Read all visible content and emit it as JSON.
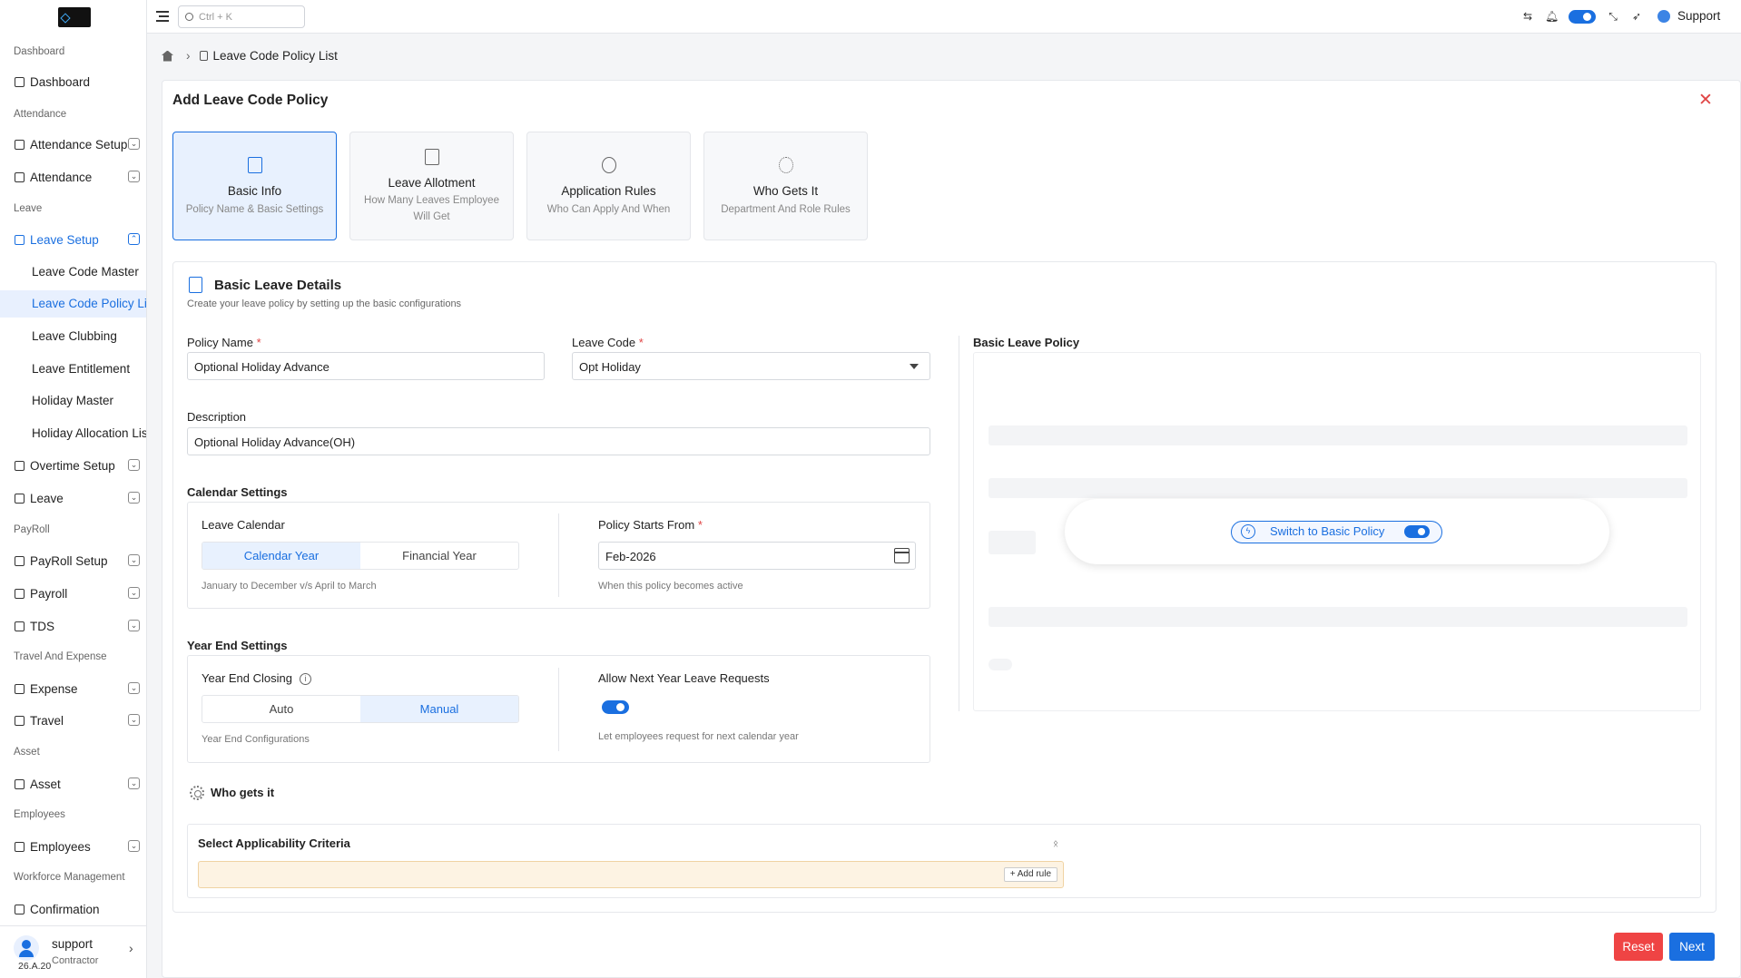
{
  "sidebar": {
    "sections": {
      "dashboard": "Dashboard",
      "attendance": "Attendance",
      "leave": "Leave",
      "payroll": "PayRoll",
      "travel": "Travel And Expense",
      "asset": "Asset",
      "employees": "Employees",
      "workforce": "Workforce Management"
    },
    "items": {
      "dashboard": "Dashboard",
      "attendance_setup": "Attendance Setup",
      "attendance": "Attendance",
      "leave_setup": "Leave Setup",
      "overtime_setup": "Overtime Setup",
      "leave": "Leave",
      "payroll_setup": "PayRoll Setup",
      "payroll": "Payroll",
      "tds": "TDS",
      "expense": "Expense",
      "travel": "Travel",
      "asset": "Asset",
      "employees": "Employees",
      "confirmation": "Confirmation"
    },
    "leave_setup_sub": [
      "Leave Code Master",
      "Leave Code Policy List",
      "Leave Clubbing",
      "Leave Entitlement",
      "Holiday Master",
      "Holiday Allocation List"
    ],
    "user": {
      "name": "support",
      "role": "Contractor",
      "version": "26.A.20"
    }
  },
  "topbar": {
    "search_placeholder": "Ctrl + K",
    "support_label": "Support"
  },
  "breadcrumb": {
    "current": "Leave Code Policy List"
  },
  "page": {
    "title": "Add Leave Code Policy"
  },
  "steps": [
    {
      "title": "Basic Info",
      "subtitle": "Policy Name & Basic Settings"
    },
    {
      "title": "Leave Allotment",
      "subtitle": "How Many Leaves Employee Will Get"
    },
    {
      "title": "Application Rules",
      "subtitle": "Who Can Apply And When"
    },
    {
      "title": "Who Gets It",
      "subtitle": "Department And Role Rules"
    }
  ],
  "basic": {
    "title": "Basic Leave Details",
    "subtitle": "Create your leave policy by setting up the basic configurations",
    "policy_name_label": "Policy Name",
    "policy_name_value": "Optional Holiday Advance",
    "leave_code_label": "Leave Code",
    "leave_code_value": "Opt Holiday",
    "description_label": "Description",
    "description_value": "Optional Holiday Advance(OH)",
    "required_mark": "*"
  },
  "calendar": {
    "title": "Calendar Settings",
    "leave_calendar_label": "Leave Calendar",
    "options": [
      "Calendar Year",
      "Financial Year"
    ],
    "selected": "Calendar Year",
    "hint": "January to December v/s April to March",
    "starts_label": "Policy Starts From",
    "starts_value": "Feb-2026",
    "starts_hint": "When this policy becomes active"
  },
  "year_end": {
    "title": "Year End Settings",
    "closing_label": "Year End Closing",
    "info_icon": "i",
    "options": [
      "Auto",
      "Manual"
    ],
    "selected": "Manual",
    "hint": "Year End Configurations",
    "allow_label": "Allow Next Year Leave Requests",
    "allow_on": true,
    "allow_hint": "Let employees request for next calendar year"
  },
  "policy_preview": {
    "title": "Basic Leave Policy",
    "switch_label": "Switch to Basic Policy",
    "switch_on": true
  },
  "who_gets": {
    "title": "Who gets it",
    "criteria_title": "Select Applicability Criteria",
    "add_rule": "+ Add rule",
    "network_glyph": "ᛟ"
  },
  "actions": {
    "reset": "Reset",
    "next": "Next"
  },
  "colors": {
    "accent": "#1a6fe0",
    "danger": "#e04545",
    "active_bg": "#e8f1fe"
  }
}
